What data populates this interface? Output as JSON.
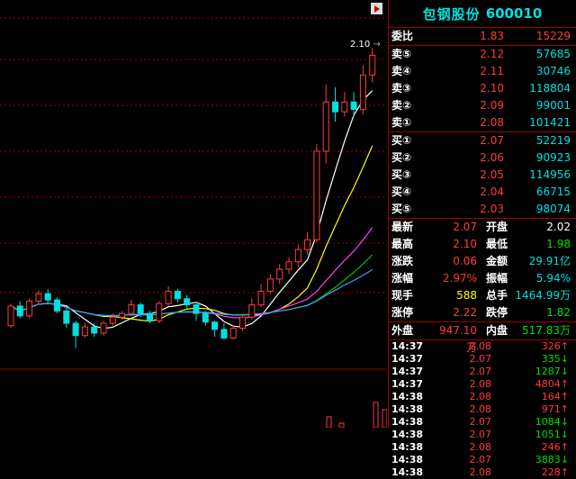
{
  "stock": {
    "name": "包钢股份",
    "code": "600010"
  },
  "chart_callout": "2.10",
  "order_book": {
    "header": {
      "label": "委比",
      "pct": "1.83",
      "diff": "15229"
    },
    "sells": [
      {
        "label": "卖⑤",
        "price": "2.12",
        "vol": "57685"
      },
      {
        "label": "卖④",
        "price": "2.11",
        "vol": "30746"
      },
      {
        "label": "卖③",
        "price": "2.10",
        "vol": "118804"
      },
      {
        "label": "卖②",
        "price": "2.09",
        "vol": "99001"
      },
      {
        "label": "卖①",
        "price": "2.08",
        "vol": "101421"
      }
    ],
    "buys": [
      {
        "label": "买①",
        "price": "2.07",
        "vol": "52219"
      },
      {
        "label": "买②",
        "price": "2.06",
        "vol": "90923"
      },
      {
        "label": "买③",
        "price": "2.05",
        "vol": "114956"
      },
      {
        "label": "买④",
        "price": "2.04",
        "vol": "66715"
      },
      {
        "label": "买⑤",
        "price": "2.03",
        "vol": "98074"
      }
    ]
  },
  "quote": {
    "rows": [
      {
        "l1": "最新",
        "v1": "2.07",
        "c1": "red",
        "l2": "开盘",
        "v2": "2.02",
        "c2": "white"
      },
      {
        "l1": "最高",
        "v1": "2.10",
        "c1": "red",
        "l2": "最低",
        "v2": "1.98",
        "c2": "green"
      },
      {
        "l1": "涨跌",
        "v1": "0.06",
        "c1": "red",
        "l2": "金额",
        "v2": "29.91亿",
        "c2": "cyan"
      },
      {
        "l1": "涨幅",
        "v1": "2.97%",
        "c1": "red",
        "l2": "振幅",
        "v2": "5.94%",
        "c2": "cyan"
      },
      {
        "l1": "现手",
        "v1": "588",
        "c1": "yellow",
        "l2": "总手",
        "v2": "1464.99万",
        "c2": "cyan"
      },
      {
        "l1": "涨停",
        "v1": "2.22",
        "c1": "red",
        "l2": "跌停",
        "v2": "1.82",
        "c2": "green"
      },
      {
        "l1": "外盘",
        "v1": "947.10万",
        "c1": "red",
        "l2": "内盘",
        "v2": "517.83万",
        "c2": "green"
      }
    ]
  },
  "ticks": [
    {
      "time": "14:37",
      "price": "2.08",
      "pc": "red",
      "vol": "326↑",
      "vc": "red"
    },
    {
      "time": "14:37",
      "price": "2.07",
      "pc": "red",
      "vol": "335↓",
      "vc": "green"
    },
    {
      "time": "14:37",
      "price": "2.07",
      "pc": "red",
      "vol": "1287↓",
      "vc": "green"
    },
    {
      "time": "14:37",
      "price": "2.08",
      "pc": "red",
      "vol": "4804↑",
      "vc": "red"
    },
    {
      "time": "14:38",
      "price": "2.08",
      "pc": "red",
      "vol": "164↑",
      "vc": "red"
    },
    {
      "time": "14:38",
      "price": "2.08",
      "pc": "red",
      "vol": "971↑",
      "vc": "red"
    },
    {
      "time": "14:38",
      "price": "2.07",
      "pc": "red",
      "vol": "1084↓",
      "vc": "green"
    },
    {
      "time": "14:38",
      "price": "2.07",
      "pc": "red",
      "vol": "1051↓",
      "vc": "green"
    },
    {
      "time": "14:38",
      "price": "2.08",
      "pc": "red",
      "vol": "246↑",
      "vc": "red"
    },
    {
      "time": "14:38",
      "price": "2.07",
      "pc": "red",
      "vol": "3883↓",
      "vc": "green"
    },
    {
      "time": "14:38",
      "price": "2.08",
      "pc": "red",
      "vol": "228↑",
      "vc": "red"
    }
  ],
  "colors": {
    "up": "#ff3c3c",
    "down": "#00e0e0",
    "grid": "#a00000",
    "ma5": "#ffffff",
    "ma10": "#ffff00",
    "ma20": "#ff40ff",
    "ma30": "#00c000",
    "ma60": "#40a0ff"
  },
  "chart_data": {
    "type": "candlestick",
    "candles": [
      [
        2.8,
        4.4,
        2.6,
        4.6
      ],
      [
        4.4,
        3.6,
        3.4,
        4.8
      ],
      [
        3.6,
        4.8,
        3.4,
        5.0
      ],
      [
        4.8,
        5.4,
        4.5,
        5.7
      ],
      [
        5.4,
        4.9,
        4.6,
        5.8
      ],
      [
        4.9,
        4.0,
        3.8,
        5.1
      ],
      [
        4.0,
        3.0,
        2.6,
        4.2
      ],
      [
        3.0,
        2.0,
        1.0,
        3.2
      ],
      [
        2.0,
        2.7,
        1.8,
        3.0
      ],
      [
        2.7,
        2.2,
        1.9,
        3.0
      ],
      [
        2.2,
        3.0,
        2.0,
        3.2
      ],
      [
        3.0,
        3.5,
        2.8,
        3.8
      ],
      [
        3.5,
        3.8,
        3.3,
        4.0
      ],
      [
        3.8,
        4.5,
        3.6,
        4.9
      ],
      [
        4.5,
        3.8,
        3.5,
        4.7
      ],
      [
        3.8,
        3.2,
        3.0,
        4.0
      ],
      [
        3.2,
        4.6,
        3.0,
        4.8
      ],
      [
        4.6,
        5.6,
        4.4,
        6.0
      ],
      [
        5.6,
        5.0,
        4.7,
        5.8
      ],
      [
        5.0,
        4.5,
        4.2,
        5.3
      ],
      [
        4.5,
        3.8,
        3.2,
        4.6
      ],
      [
        3.8,
        3.1,
        2.8,
        4.0
      ],
      [
        3.1,
        2.5,
        1.9,
        3.2
      ],
      [
        2.5,
        1.8,
        1.7,
        3.0
      ],
      [
        1.8,
        2.6,
        1.7,
        2.8
      ],
      [
        2.6,
        3.5,
        2.4,
        3.7
      ],
      [
        3.5,
        4.5,
        3.3,
        5.0
      ],
      [
        4.5,
        5.6,
        4.3,
        6.2
      ],
      [
        5.6,
        6.6,
        5.4,
        7.0
      ],
      [
        6.6,
        7.4,
        6.2,
        7.8
      ],
      [
        7.4,
        8.0,
        7.0,
        8.4
      ],
      [
        8.0,
        9.0,
        7.6,
        9.4
      ],
      [
        9.0,
        9.8,
        8.6,
        10.4
      ],
      [
        9.8,
        17.0,
        9.6,
        17.6
      ],
      [
        17.0,
        21.0,
        16.0,
        22.4
      ],
      [
        21.0,
        20.2,
        19.4,
        22.2
      ],
      [
        20.2,
        21.0,
        19.8,
        21.8
      ],
      [
        21.0,
        20.4,
        19.8,
        21.8
      ],
      [
        20.4,
        23.2,
        20.0,
        24.0
      ],
      [
        23.2,
        24.8,
        22.6,
        25.4
      ]
    ]
  }
}
